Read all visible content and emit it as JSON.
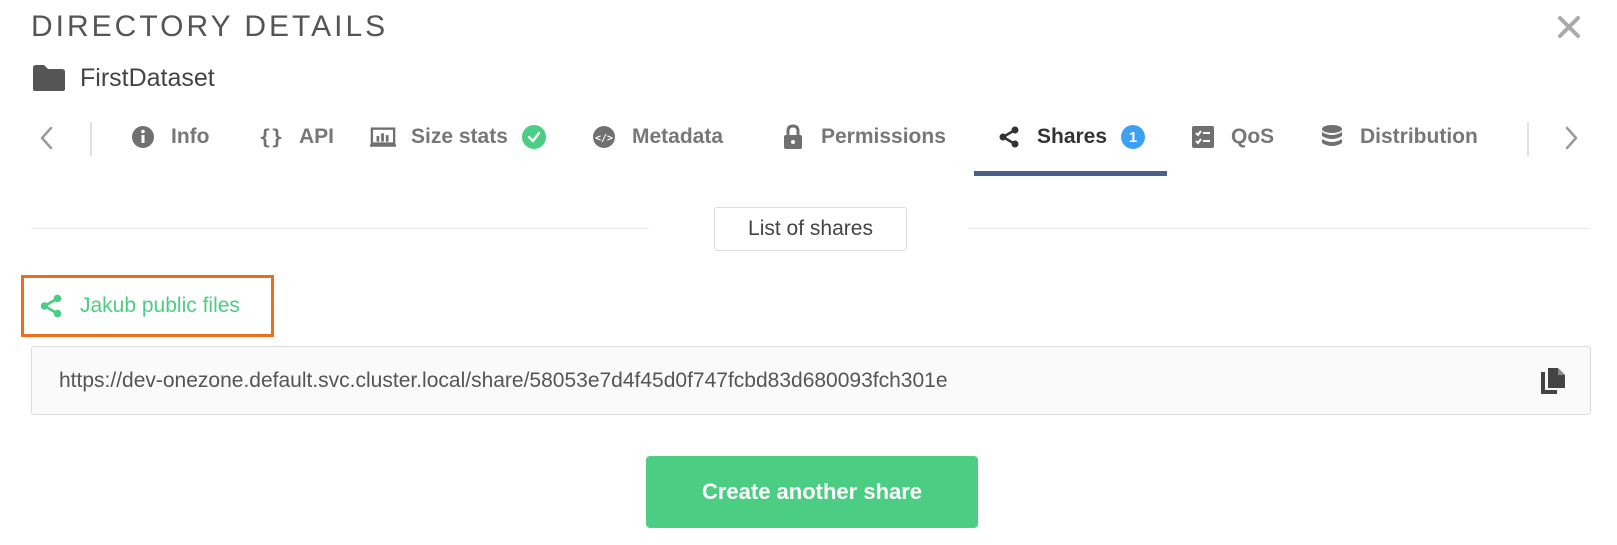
{
  "modal": {
    "title": "DIRECTORY DETAILS",
    "close_icon": "close-icon"
  },
  "item": {
    "icon": "folder-icon",
    "name": "FirstDataset"
  },
  "tabs": [
    {
      "label": "Info",
      "icon": "info-icon"
    },
    {
      "label": "API",
      "icon": "braces-icon"
    },
    {
      "label": "Size stats",
      "icon": "size-stats-icon",
      "status": "check-icon"
    },
    {
      "label": "Metadata",
      "icon": "metadata-icon"
    },
    {
      "label": "Permissions",
      "icon": "lock-icon"
    },
    {
      "label": "Shares",
      "icon": "share-icon",
      "badge": "1",
      "active": true
    },
    {
      "label": "QoS",
      "icon": "qos-icon"
    },
    {
      "label": "Distribution",
      "icon": "database-icon"
    }
  ],
  "shares_panel": {
    "header": "List of shares",
    "share": {
      "name": "Jakub public files",
      "icon": "share-icon",
      "url": "https://dev-onezone.default.svc.cluster.local/share/58053e7d4f45d0f747fcbd83d680093fch301e"
    },
    "copy_icon": "copy-icon",
    "create_button": "Create another share"
  },
  "colors": {
    "accent_green": "#4bce83",
    "active_tab_underline": "#4a5f8c",
    "badge_blue": "#3ea1ef",
    "highlight_orange": "#ee6e1b"
  }
}
